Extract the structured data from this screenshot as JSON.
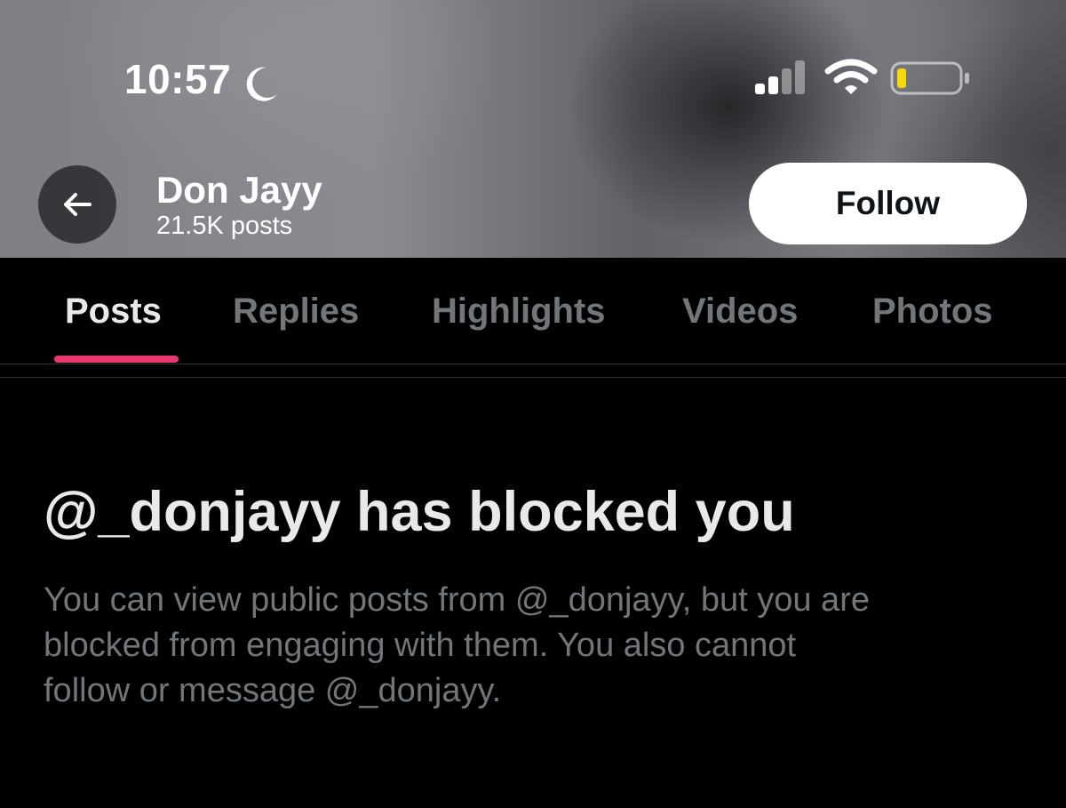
{
  "status_bar": {
    "time": "10:57",
    "moon_icon": "moon-icon",
    "signal_icon": "cellular-signal-icon",
    "wifi_icon": "wifi-icon",
    "battery_icon": "battery-low-icon",
    "battery_fill_color": "#f5d90a"
  },
  "profile": {
    "name": "Don Jayy",
    "post_count": "21.5K posts",
    "follow_label": "Follow",
    "back_icon": "back-arrow-icon"
  },
  "tabs": [
    {
      "label": "Posts",
      "active": true
    },
    {
      "label": "Replies",
      "active": false
    },
    {
      "label": "Highlights",
      "active": false
    },
    {
      "label": "Videos",
      "active": false
    },
    {
      "label": "Photos",
      "active": false
    }
  ],
  "tab_indicator_color": "#e8366e",
  "blocked": {
    "title": "@_donjayy has blocked you",
    "line1": "You can view public posts from @_donjayy, but you are",
    "line2": "blocked from engaging with them. You also cannot",
    "line3": "follow or message @_donjayy."
  }
}
